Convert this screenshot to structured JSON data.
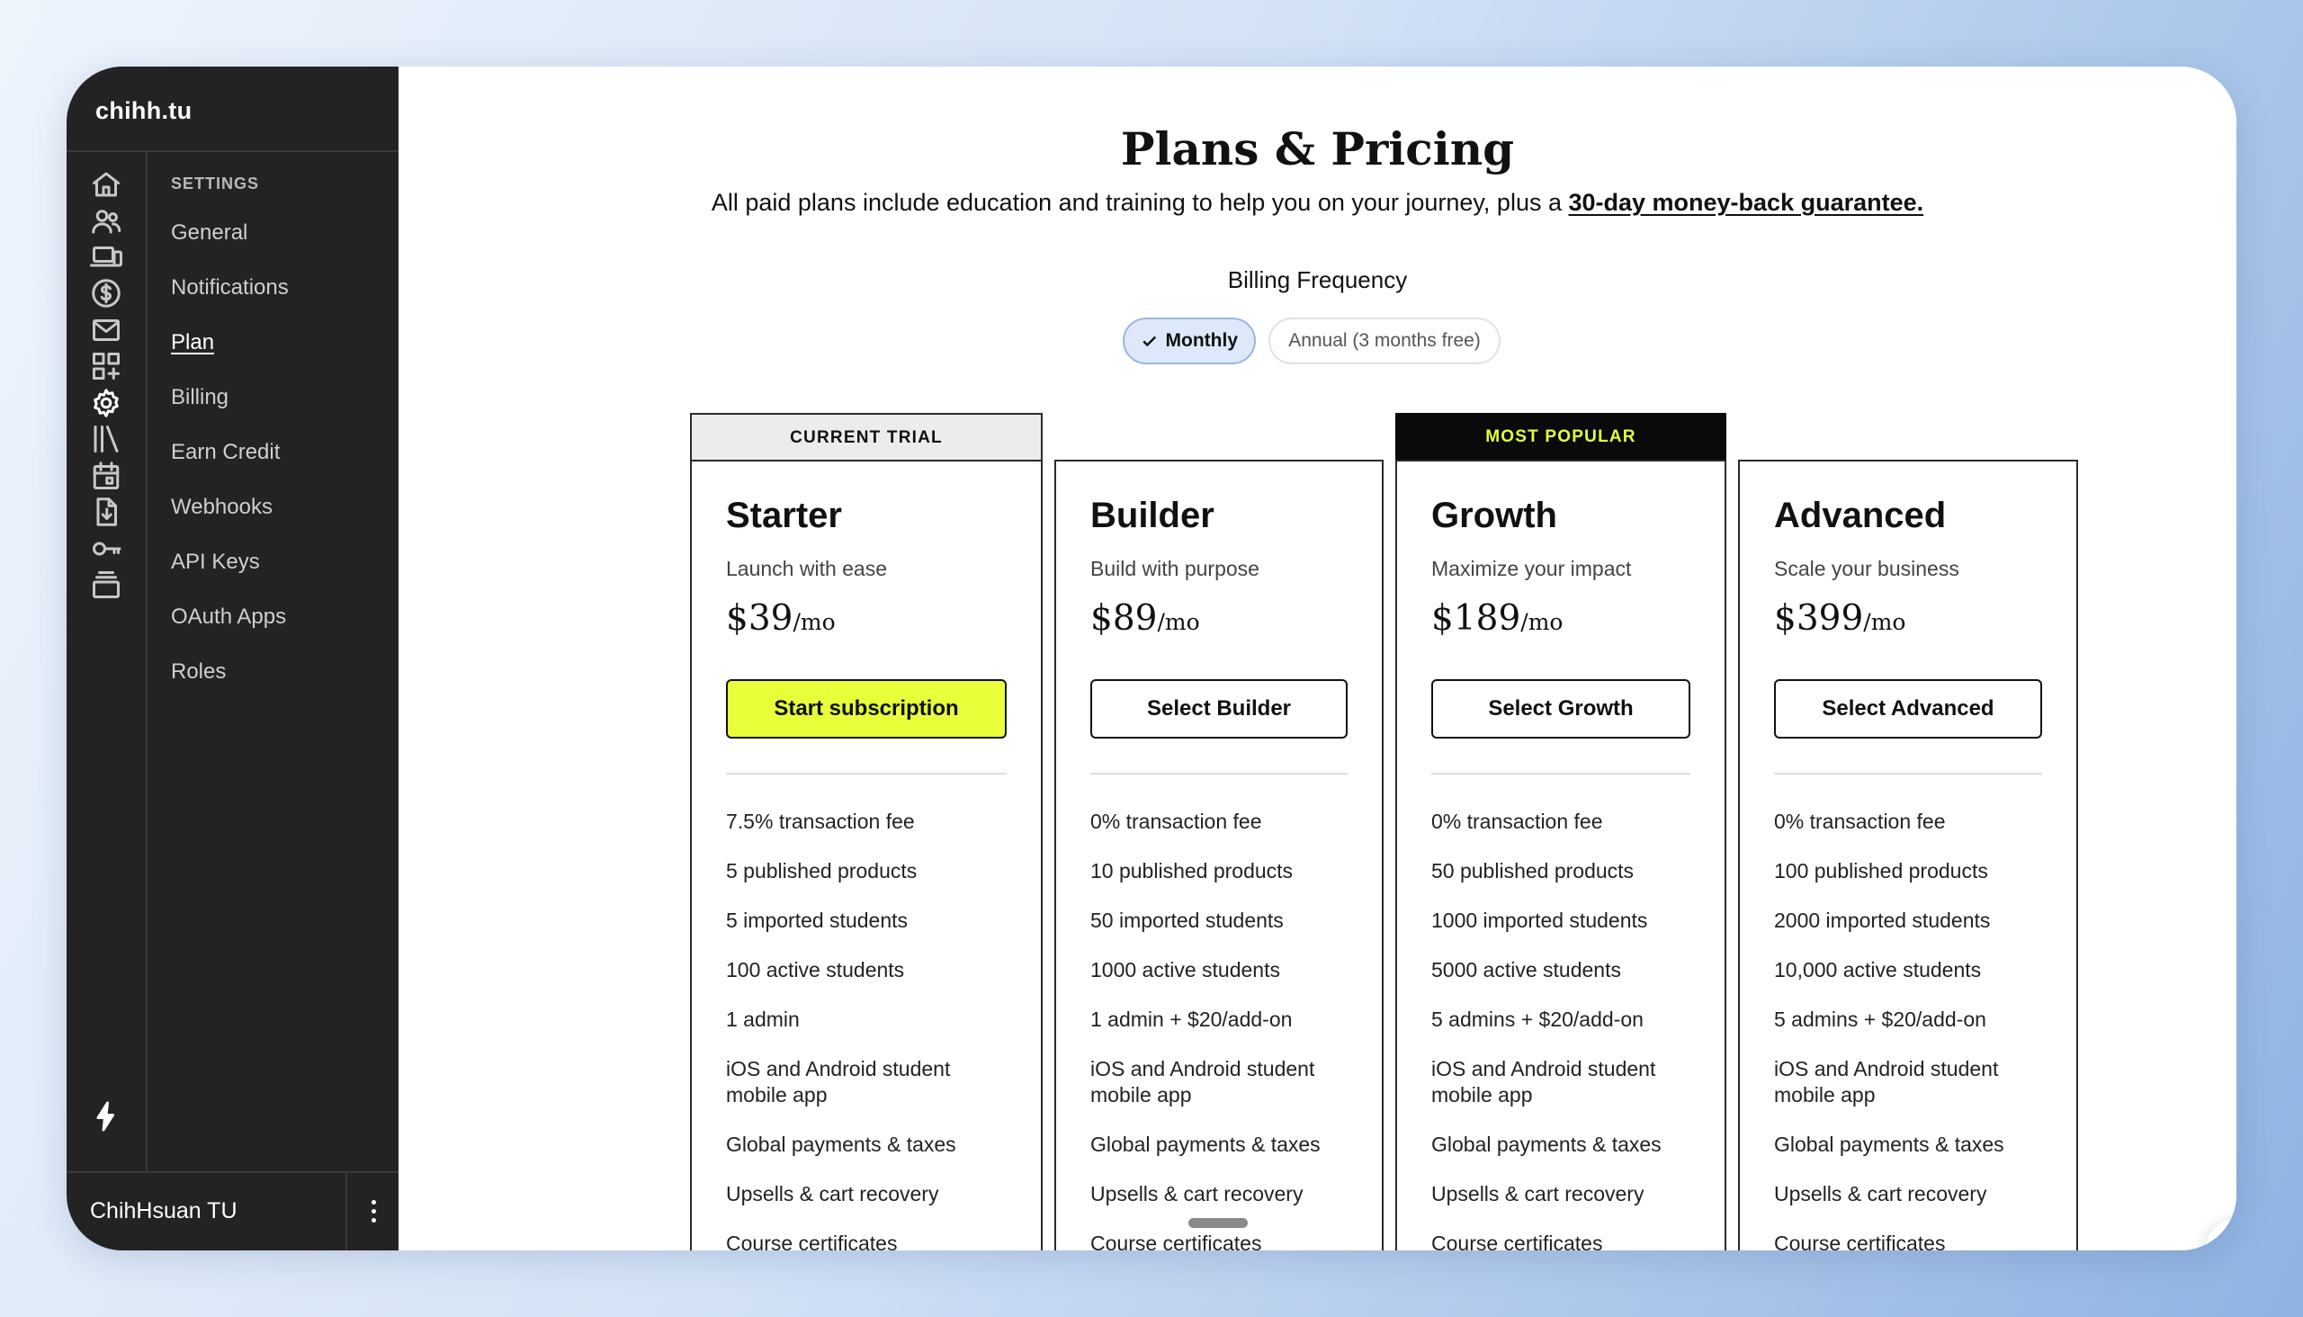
{
  "brand": "chihh.tu",
  "user": {
    "name": "ChihHsuan TU"
  },
  "nav": {
    "heading": "SETTINGS",
    "items": [
      "General",
      "Notifications",
      "Plan",
      "Billing",
      "Earn Credit",
      "Webhooks",
      "API Keys",
      "OAuth Apps",
      "Roles"
    ],
    "active": "Plan"
  },
  "rail_icons": [
    "home-icon",
    "users-icon",
    "devices-icon",
    "dollar-icon",
    "mail-icon",
    "apps-icon",
    "gear-icon",
    "library-icon",
    "calendar-icon",
    "download-doc-icon",
    "key-icon",
    "stack-icon",
    "lightning-icon"
  ],
  "header": {
    "title": "Plans & Pricing",
    "subtitle_text": "All paid plans include education and training to help you on your journey, plus a ",
    "subtitle_link": "30-day money-back guarantee."
  },
  "billing": {
    "label": "Billing Frequency",
    "monthly": "Monthly",
    "annual": "Annual (3 months free)",
    "selected": "Monthly"
  },
  "plans": [
    {
      "banner": "CURRENT TRIAL",
      "name": "Starter",
      "tagline": "Launch with ease",
      "price": "$39",
      "per": "/mo",
      "button": "Start subscription",
      "features": [
        "7.5% transaction fee",
        "5 published products",
        "5 imported students",
        "100 active students",
        "1 admin",
        "iOS and Android student mobile app",
        "Global payments & taxes",
        "Upsells & cart recovery",
        "Course certificates"
      ]
    },
    {
      "banner": "",
      "name": "Builder",
      "tagline": "Build with purpose",
      "price": "$89",
      "per": "/mo",
      "button": "Select Builder",
      "features": [
        "0% transaction fee",
        "10 published products",
        "50 imported students",
        "1000 active students",
        "1 admin + $20/add-on",
        "iOS and Android student mobile app",
        "Global payments & taxes",
        "Upsells & cart recovery",
        "Course certificates"
      ]
    },
    {
      "banner": "MOST POPULAR",
      "name": "Growth",
      "tagline": "Maximize your impact",
      "price": "$189",
      "per": "/mo",
      "button": "Select Growth",
      "features": [
        "0% transaction fee",
        "50 published products",
        "1000 imported students",
        "5000 active students",
        "5 admins + $20/add-on",
        "iOS and Android student mobile app",
        "Global payments & taxes",
        "Upsells & cart recovery",
        "Course certificates"
      ]
    },
    {
      "banner": "",
      "name": "Advanced",
      "tagline": "Scale your business",
      "price": "$399",
      "per": "/mo",
      "button": "Select Advanced",
      "features": [
        "0% transaction fee",
        "100 published products",
        "2000 imported students",
        "10,000 active students",
        "5 admins + $20/add-on",
        "iOS and Android student mobile app",
        "Global payments & taxes",
        "Upsells & cart recovery",
        "Course certificates"
      ]
    }
  ],
  "colors": {
    "accent_yellow": "#e8ff3a",
    "sidebar_bg": "#232323",
    "popular_banner_text": "#e4ff3a"
  }
}
